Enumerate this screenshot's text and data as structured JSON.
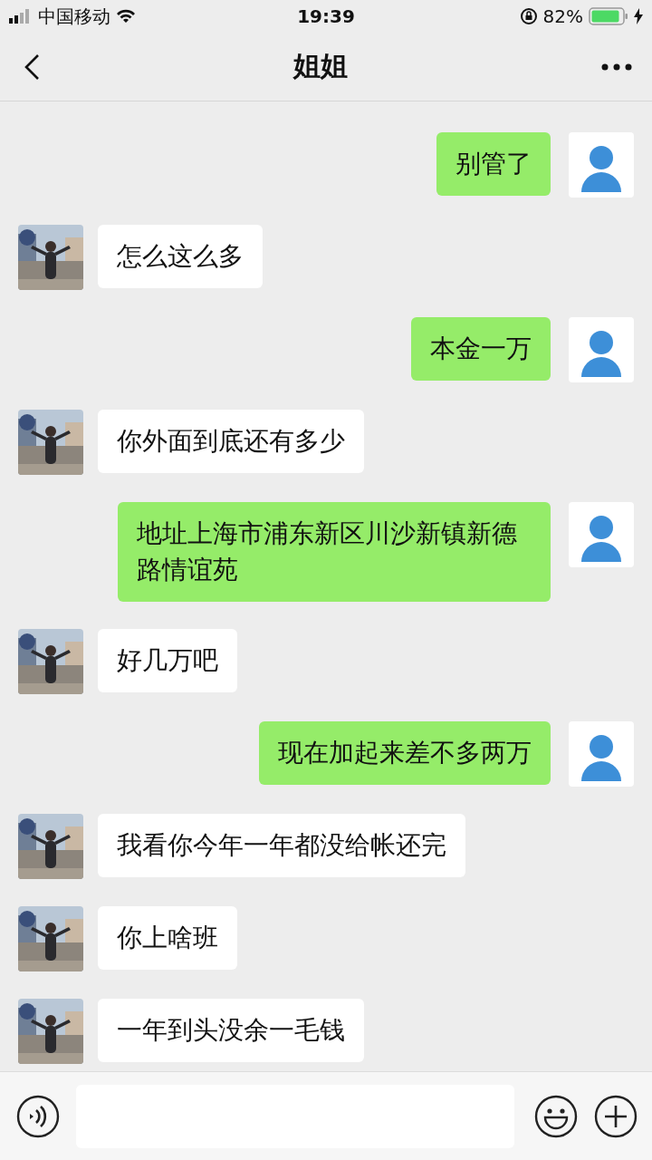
{
  "status_bar": {
    "carrier": "中国移动",
    "time": "19:39",
    "battery": "82%"
  },
  "nav": {
    "title": "姐姐"
  },
  "messages": [
    {
      "kind": "sent",
      "text": "别管了"
    },
    {
      "kind": "received",
      "text": "怎么这么多"
    },
    {
      "kind": "sent",
      "text": "本金一万"
    },
    {
      "kind": "received",
      "text": "你外面到底还有多少"
    },
    {
      "kind": "sent",
      "text": "地址上海市浦东新区川沙新镇新德路情谊苑"
    },
    {
      "kind": "received",
      "text": "好几万吧"
    },
    {
      "kind": "sent",
      "text": "现在加起来差不多两万"
    },
    {
      "kind": "received",
      "text": "我看你今年一年都没给帐还完"
    },
    {
      "kind": "received",
      "text": "你上啥班"
    },
    {
      "kind": "received",
      "text": "一年到头没余一毛钱"
    }
  ]
}
